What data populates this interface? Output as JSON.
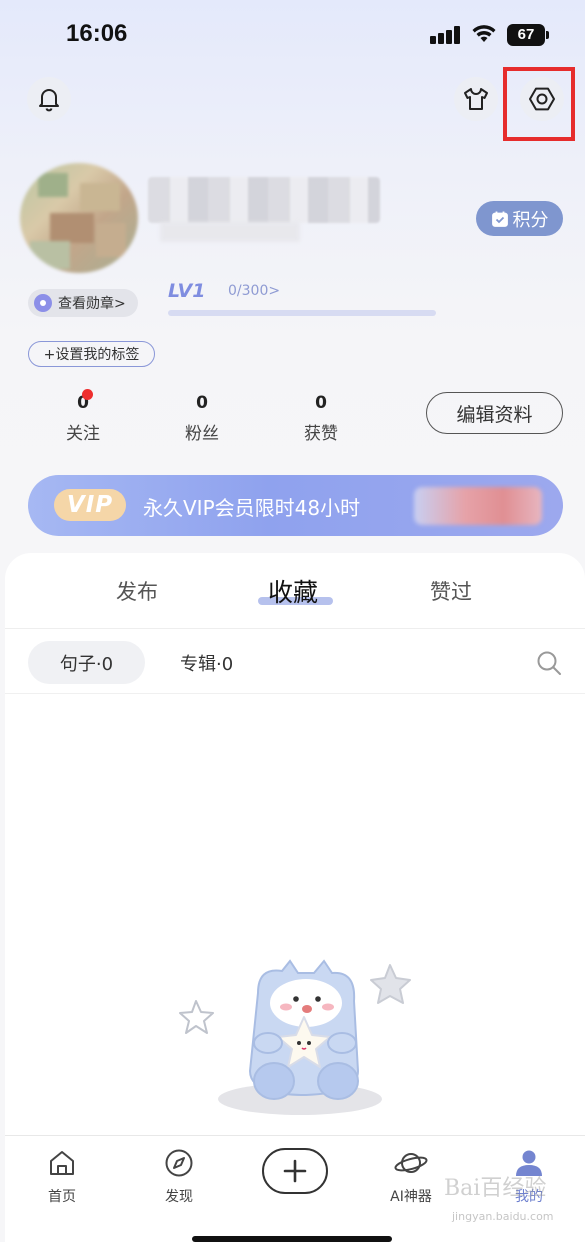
{
  "status_bar": {
    "time": "16:06",
    "battery": "67"
  },
  "header": {
    "icons": [
      "bell-icon",
      "shirt-icon",
      "gear-icon"
    ]
  },
  "profile": {
    "points_label": "积分",
    "badge_label": "查看勋章>",
    "level": "LV1",
    "level_progress": "0/300>",
    "level_fraction": 0,
    "tag_label": "+设置我的标签",
    "edit_label": "编辑资料"
  },
  "stats": [
    {
      "value": "0",
      "label": "关注"
    },
    {
      "value": "0",
      "label": "粉丝"
    },
    {
      "value": "0",
      "label": "获赞"
    }
  ],
  "vip": {
    "badge": "VIP",
    "text": "永久VIP会员限时48小时"
  },
  "tabs": {
    "publish": "发布",
    "collect": "收藏",
    "liked": "赞过",
    "active": "collect"
  },
  "filters": {
    "sentence": "句子·0",
    "album": "专辑·0"
  },
  "bottom_nav": {
    "home": "首页",
    "discover": "发现",
    "ai": "AI神器",
    "me": "我的"
  },
  "watermark": {
    "main": "Bai百经验",
    "sub": "jingyan.baidu.com"
  },
  "colors": {
    "accent": "#7f96cf",
    "highlight": "#e62c2c",
    "notification": "#ee2e2e",
    "vip_gradient_start": "#a6b8f3",
    "vip_gradient_end": "#9ca8ee"
  }
}
